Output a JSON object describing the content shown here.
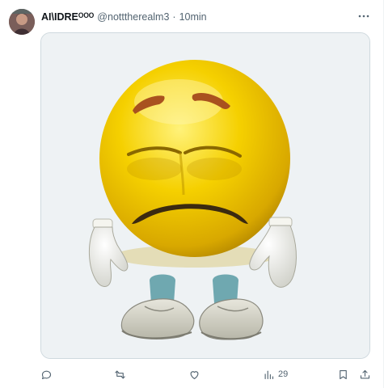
{
  "post": {
    "author": {
      "display_name": "AI\\IDREᴼᴼᴼ",
      "handle": "@notttherealm3",
      "separator": "·",
      "time": "10min"
    },
    "media": {
      "kind": "image",
      "icon": "sad-emoji-image"
    },
    "actions": {
      "reply": {
        "icon": "reply-icon"
      },
      "repost": {
        "icon": "repost-icon"
      },
      "like": {
        "icon": "heart-icon"
      },
      "views": {
        "icon": "views-icon",
        "count": "29"
      },
      "bookmark": {
        "icon": "bookmark-icon"
      },
      "share": {
        "icon": "share-icon"
      }
    }
  },
  "colors": {
    "text_primary": "#0f1419",
    "text_secondary": "#536471",
    "border": "#cfd9de",
    "emoji_yellow": "#f2c800"
  }
}
